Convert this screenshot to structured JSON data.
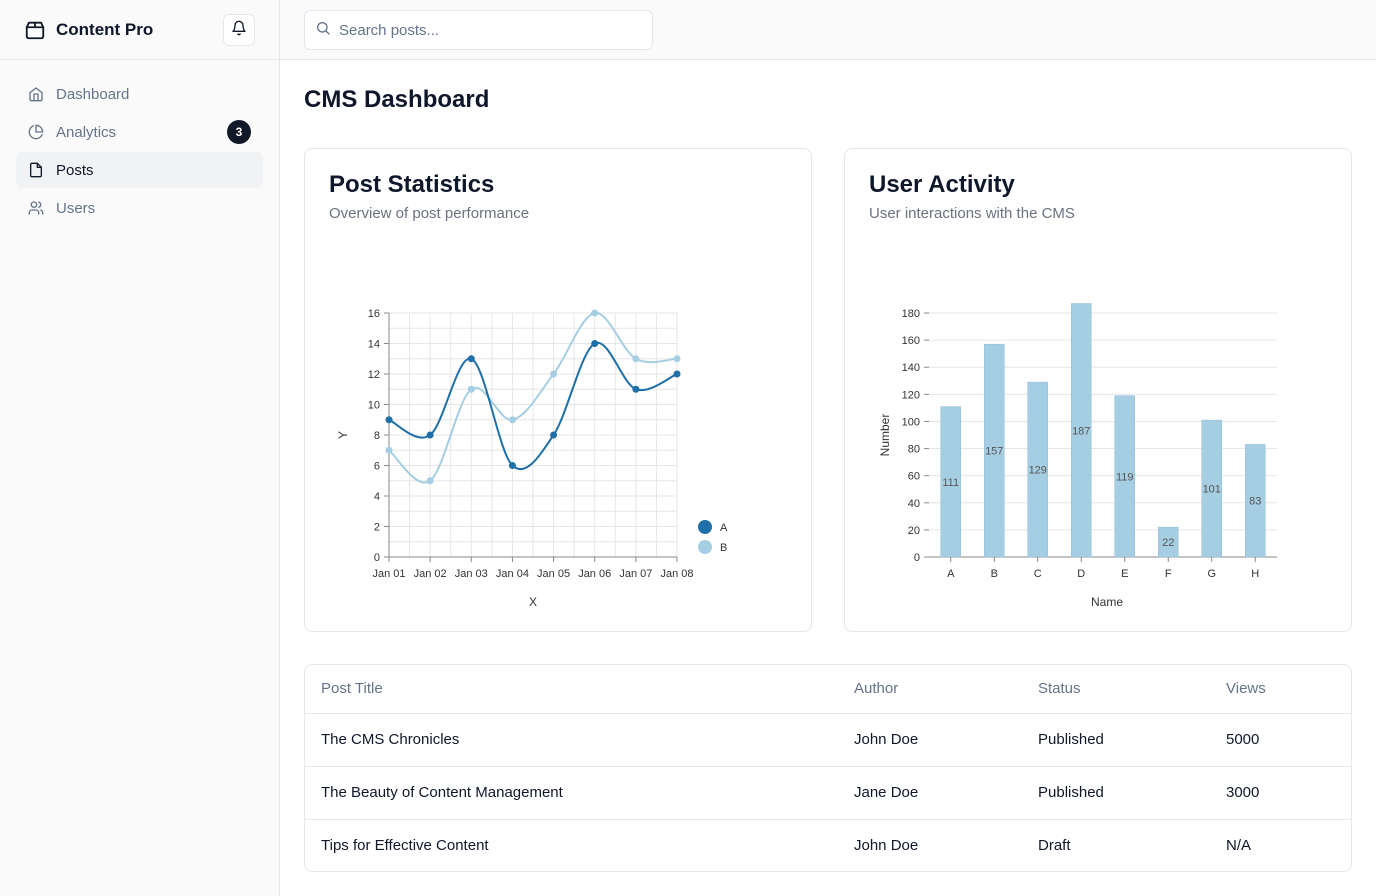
{
  "app": {
    "name": "Content Pro"
  },
  "sidebar": {
    "items": [
      {
        "label": "Dashboard",
        "icon": "home-icon"
      },
      {
        "label": "Analytics",
        "icon": "pie-chart-icon",
        "badge": "3"
      },
      {
        "label": "Posts",
        "icon": "file-icon",
        "active": true
      },
      {
        "label": "Users",
        "icon": "users-icon"
      }
    ]
  },
  "search": {
    "placeholder": "Search posts..."
  },
  "page": {
    "title": "CMS Dashboard"
  },
  "cards": {
    "post_stats": {
      "title": "Post Statistics",
      "subtitle": "Overview of post performance"
    },
    "user_activity": {
      "title": "User Activity",
      "subtitle": "User interactions with the CMS"
    }
  },
  "chart_data": [
    {
      "type": "line",
      "x": [
        "Jan 01",
        "Jan 02",
        "Jan 03",
        "Jan 04",
        "Jan 05",
        "Jan 06",
        "Jan 07",
        "Jan 08"
      ],
      "series": [
        {
          "name": "A",
          "values": [
            9,
            8,
            13,
            6,
            8,
            14,
            11,
            12
          ],
          "color": "#1f6fa8"
        },
        {
          "name": "B",
          "values": [
            7,
            5,
            11,
            9,
            12,
            16,
            13,
            13
          ],
          "color": "#a6cee3"
        }
      ],
      "xlabel": "X",
      "ylabel": "Y",
      "ylim": [
        0,
        16
      ],
      "yticks": [
        0,
        2,
        4,
        6,
        8,
        10,
        12,
        14,
        16
      ],
      "grid": true,
      "legend": "bottom-right"
    },
    {
      "type": "bar",
      "categories": [
        "A",
        "B",
        "C",
        "D",
        "E",
        "F",
        "G",
        "H"
      ],
      "values": [
        111,
        157,
        129,
        187,
        119,
        22,
        101,
        83
      ],
      "xlabel": "Name",
      "ylabel": "Number",
      "ylim": [
        0,
        180
      ],
      "yticks": [
        0,
        20,
        40,
        60,
        80,
        100,
        120,
        140,
        160,
        180
      ],
      "color": "#a6cee3",
      "grid": true
    }
  ],
  "table": {
    "headers": [
      "Post Title",
      "Author",
      "Status",
      "Views"
    ],
    "rows": [
      [
        "The CMS Chronicles",
        "John Doe",
        "Published",
        "5000"
      ],
      [
        "The Beauty of Content Management",
        "Jane Doe",
        "Published",
        "3000"
      ],
      [
        "Tips for Effective Content",
        "John Doe",
        "Draft",
        "N/A"
      ]
    ]
  }
}
